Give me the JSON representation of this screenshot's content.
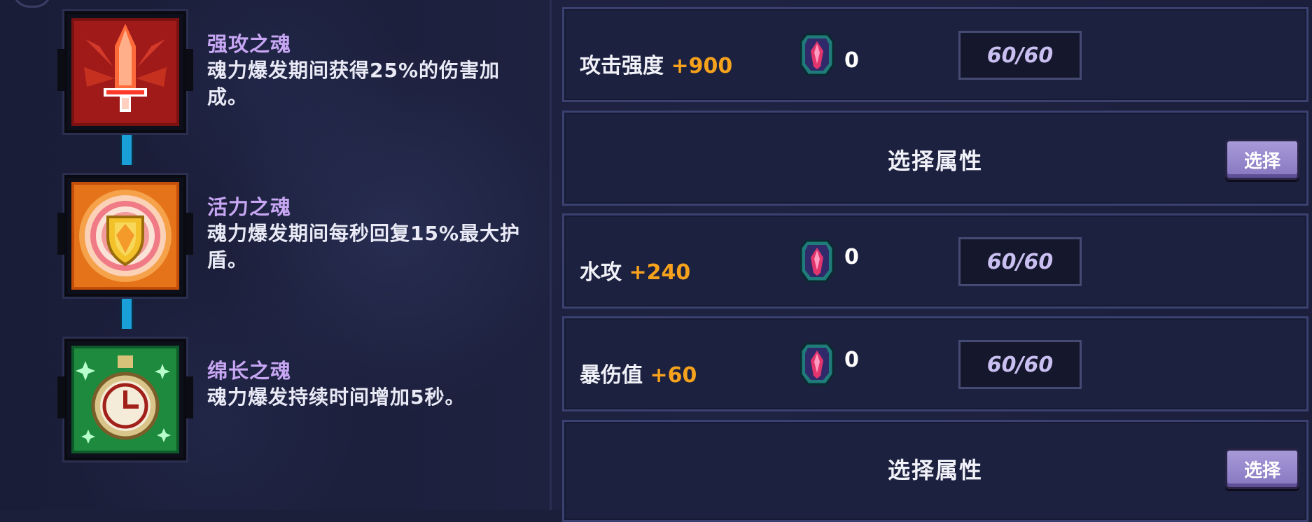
{
  "skills": [
    {
      "name": "强攻之魂",
      "desc": "魂力爆发期间获得25%的伤害加成。",
      "icon": "red-winged-sword-icon"
    },
    {
      "name": "活力之魂",
      "desc": "魂力爆发期间每秒回复15%最大护盾。",
      "icon": "golden-shield-icon"
    },
    {
      "name": "绵长之魂",
      "desc": "魂力爆发持续时间增加5秒。",
      "icon": "green-stopwatch-icon"
    }
  ],
  "attributes": [
    {
      "label": "攻击强度",
      "bonus": "+900",
      "gem_count": "0",
      "slot": "60/60"
    },
    {
      "label": "水攻",
      "bonus": "+240",
      "gem_count": "0",
      "slot": "60/60"
    },
    {
      "label": "暴伤值",
      "bonus": "+60",
      "gem_count": "0",
      "slot": "60/60"
    }
  ],
  "select_panels": [
    {
      "title": "选择属性",
      "button": "选择"
    },
    {
      "title": "选择属性",
      "button": "选择"
    }
  ],
  "colors": {
    "skill_name": "#c7a6f3",
    "bonus": "#f6a21c",
    "connector": "#1aa0d8",
    "button": "#9a8cd0"
  }
}
